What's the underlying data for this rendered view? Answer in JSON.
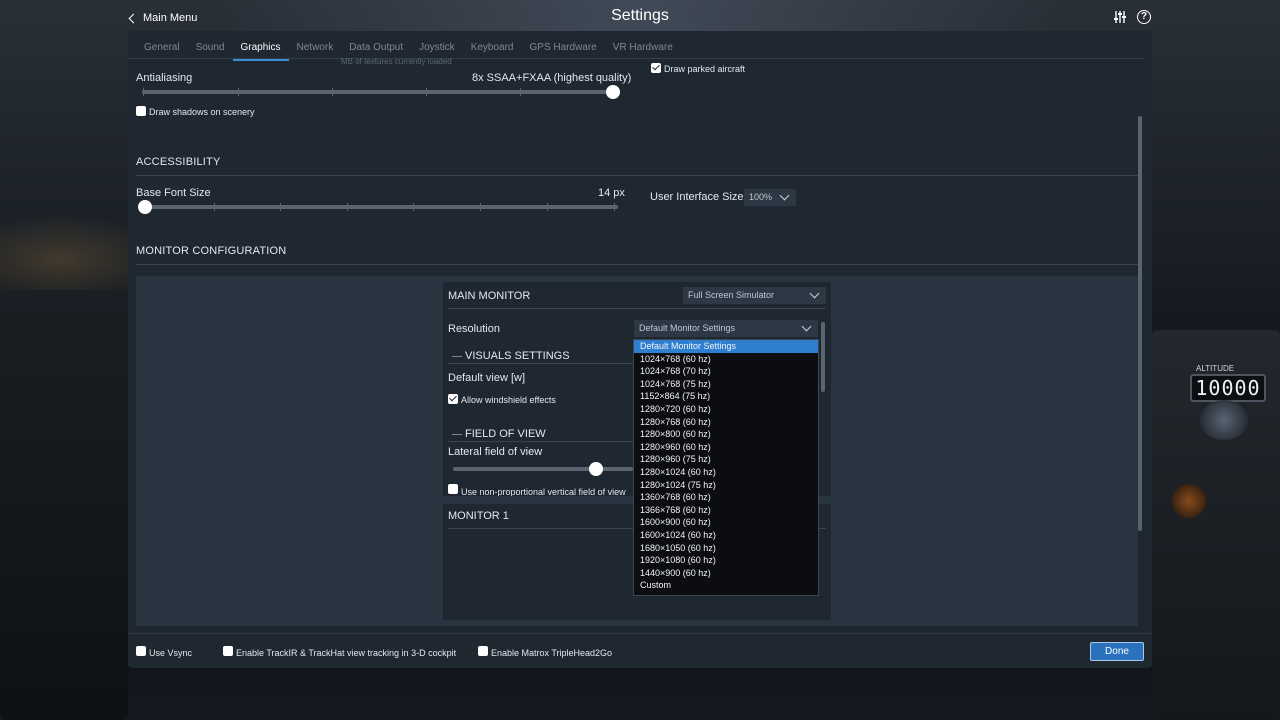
{
  "header": {
    "back_label": "Main Menu",
    "title": "Settings"
  },
  "background": {
    "altitude_label": "ALTITUDE",
    "altitude_value": "10000"
  },
  "tabs": [
    {
      "label": "General"
    },
    {
      "label": "Sound"
    },
    {
      "label": "Graphics",
      "active": true
    },
    {
      "label": "Network"
    },
    {
      "label": "Data Output"
    },
    {
      "label": "Joystick"
    },
    {
      "label": "Keyboard"
    },
    {
      "label": "GPS Hardware"
    },
    {
      "label": "VR Hardware"
    }
  ],
  "graphics": {
    "textures_note": "MB of textures currently loaded",
    "antialiasing": {
      "label": "Antialiasing",
      "value": "8x SSAA+FXAA (highest quality)",
      "level": 1.0
    },
    "draw_shadows": {
      "label": "Draw shadows on scenery",
      "checked": false
    },
    "draw_parked": {
      "label": "Draw parked aircraft",
      "checked": true
    }
  },
  "accessibility": {
    "heading": "ACCESSIBILITY",
    "base_font": {
      "label": "Base Font Size",
      "value": "14 px",
      "level": 0.0
    },
    "ui_size": {
      "label": "User Interface Size",
      "value": "100%"
    }
  },
  "monitor_config": {
    "heading": "MONITOR CONFIGURATION",
    "main_monitor": {
      "title": "MAIN MONITOR",
      "mode": "Full Screen Simulator",
      "resolution_label": "Resolution",
      "resolution_value": "Default Monitor Settings",
      "visuals_heading": "VISUALS SETTINGS",
      "default_view_label": "Default view [w]",
      "allow_windshield": {
        "label": "Allow windshield effects",
        "checked": true
      },
      "fov_heading": "FIELD OF VIEW",
      "lateral_fov_label": "Lateral field of view",
      "non_proportional": {
        "label": "Use non-proportional vertical field of view",
        "checked": false
      }
    },
    "monitor1_title": "MONITOR 1",
    "resolution_options": [
      "Default Monitor Settings",
      "1024×768 (60 hz)",
      "1024×768 (70 hz)",
      "1024×768 (75 hz)",
      "1152×864 (75 hz)",
      "1280×720 (60 hz)",
      "1280×768 (60 hz)",
      "1280×800 (60 hz)",
      "1280×960 (60 hz)",
      "1280×960 (75 hz)",
      "1280×1024 (60 hz)",
      "1280×1024 (75 hz)",
      "1360×768 (60 hz)",
      "1366×768 (60 hz)",
      "1600×900 (60 hz)",
      "1600×1024 (60 hz)",
      "1680×1050 (60 hz)",
      "1920×1080 (60 hz)",
      "1440×900 (60 hz)",
      "Custom"
    ]
  },
  "footer": {
    "vsync": {
      "label": "Use Vsync",
      "checked": false
    },
    "trackir": {
      "label": "Enable TrackIR & TrackHat view tracking in 3-D cockpit",
      "checked": false
    },
    "matrox": {
      "label": "Enable Matrox TripleHead2Go",
      "checked": false
    },
    "done_label": "Done"
  },
  "colors": {
    "accent": "#2f7fd1",
    "window_bg": "#1f2731",
    "panel_bg": "#293441"
  }
}
